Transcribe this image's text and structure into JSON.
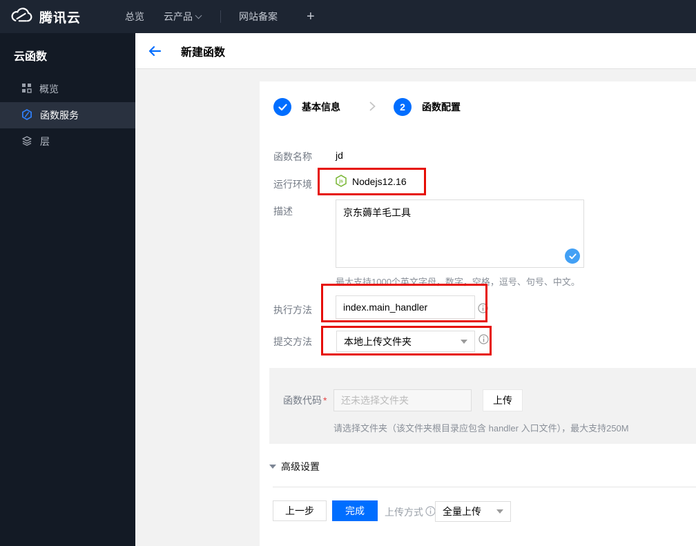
{
  "navbar": {
    "brand": "腾讯云",
    "overview": "总览",
    "products": "云产品",
    "icp": "网站备案",
    "plus": "+"
  },
  "sidebar": {
    "title": "云函数",
    "items": [
      {
        "label": "概览",
        "icon": "grid-icon"
      },
      {
        "label": "函数服务",
        "icon": "scf-hexagon-icon"
      },
      {
        "label": "层",
        "icon": "layers-icon"
      }
    ]
  },
  "header": {
    "title": "新建函数"
  },
  "steps": [
    {
      "num": "✓",
      "label": "基本信息"
    },
    {
      "num": "2",
      "label": "函数配置"
    }
  ],
  "form": {
    "name_label": "函数名称",
    "name_value": "jd",
    "runtime_label": "运行环境",
    "runtime_value": "Nodejs12.16",
    "desc_label": "描述",
    "desc_value": "京东薅羊毛工具",
    "desc_hint": "最大支持1000个英文字母，数字，空格，逗号、句号、中文。",
    "handler_label": "执行方法",
    "handler_value": "index.main_handler",
    "submit_label": "提交方法",
    "submit_value": "本地上传文件夹",
    "code_label": "函数代码",
    "code_required": "*",
    "code_placeholder": "还未选择文件夹",
    "upload_button": "上传",
    "code_hint": "请选择文件夹（该文件夹根目录应包含 handler 入口文件），最大支持250M",
    "advanced": "高级设置"
  },
  "footer": {
    "prev": "上一步",
    "finish": "完成",
    "upload_mode_label": "上传方式",
    "upload_mode_value": "全量上传"
  },
  "colors": {
    "accent": "#006eff",
    "annotation_red": "#e60d05",
    "node_green": "#7fb93d",
    "badge_blue": "#42a0f5"
  }
}
